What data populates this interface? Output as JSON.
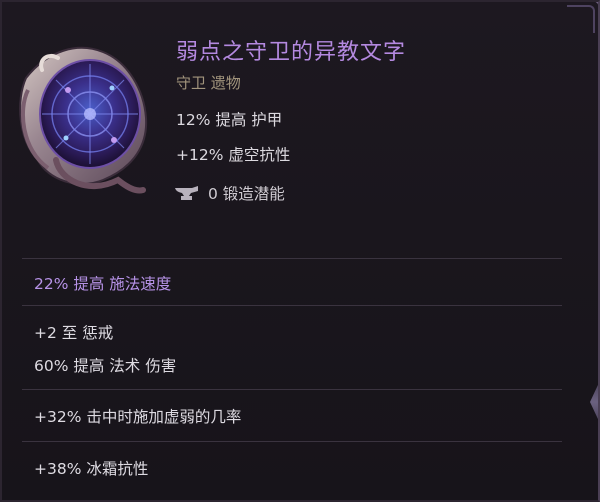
{
  "item": {
    "name": "弱点之守卫的异教文字",
    "subtitle": "守卫 遗物",
    "implicits": [
      "12% 提高 护甲",
      "+12% 虚空抗性"
    ],
    "forge_potential": "0 锻造潜能",
    "icons": {
      "item": "relic-icon",
      "forge": "anvil-icon"
    }
  },
  "affixes": [
    "22% 提高 施法速度",
    "+2 至 惩戒",
    "60% 提高 法术 伤害",
    "+32% 击中时施加虚弱的几率",
    "+38% 冰霜抗性"
  ],
  "colors": {
    "name": "#b489e0",
    "subtitle": "#a2957d",
    "highlight": "#b692e6",
    "text": "#dedbe2",
    "background": "#1a161d"
  }
}
